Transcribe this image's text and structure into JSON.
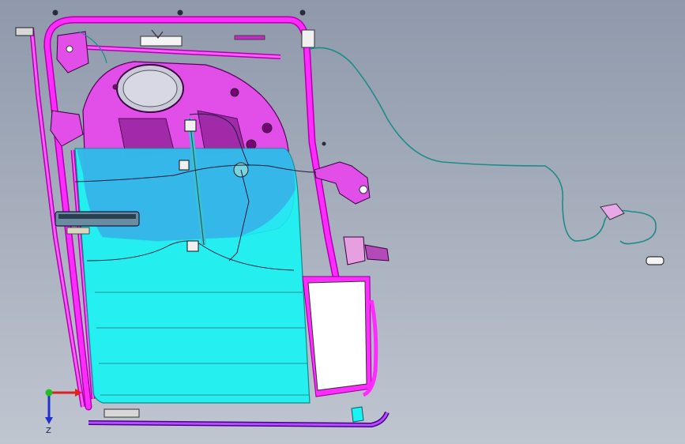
{
  "viewport": {
    "background_top": "#8f99ab",
    "background_bottom": "#c0c6d0"
  },
  "colors": {
    "frame": "#ff2bff",
    "frame_dark": "#b000b0",
    "inner_panel": "#e14fe8",
    "glass": "#19f3f3",
    "glass_overlap": "#39a8e6",
    "wire": "#1e8a8a",
    "linework": "#1b1b3a",
    "white_panel": "#ffffff"
  },
  "triad": {
    "x_axis_color": "#e02020",
    "y_axis_color": "#20c020",
    "z_axis_color": "#2030d0",
    "z_label": "Z"
  },
  "model": {
    "components": [
      "door-frame",
      "inner-panel",
      "window-glass",
      "window-regulator",
      "cable-harness",
      "door-handle",
      "quarter-glass",
      "lower-sill-trim"
    ]
  }
}
